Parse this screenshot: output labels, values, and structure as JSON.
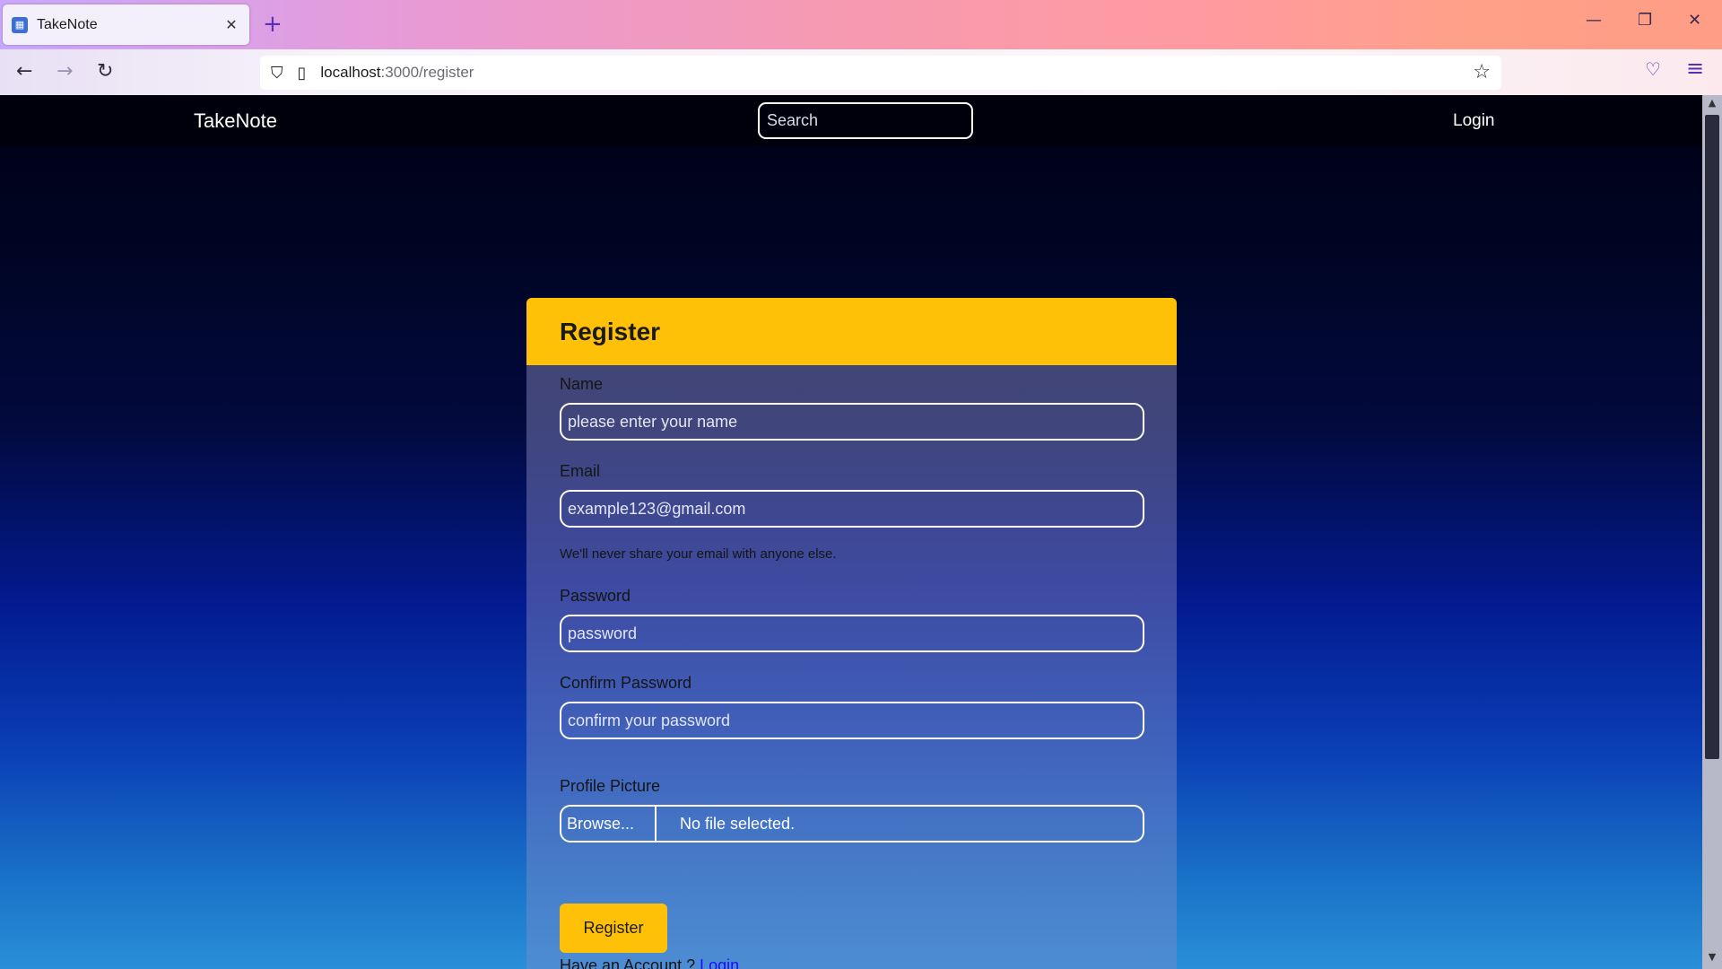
{
  "browser": {
    "tab_title": "TakeNote",
    "tab_close": "✕",
    "new_tab": "+",
    "window_controls": {
      "minimize": "—",
      "restore": "❐",
      "close": "✕"
    },
    "nav": {
      "back": "←",
      "forward": "→",
      "reload": "↻"
    },
    "url": {
      "host": "localhost",
      "path": ":3000/register",
      "shield": "⛉",
      "page": "▯"
    },
    "bookmark_star": "☆",
    "pocket": "♡",
    "menu": "≡"
  },
  "site": {
    "brand": "TakeNote",
    "search_placeholder": "Search",
    "login": "Login"
  },
  "form": {
    "title": "Register",
    "name_label": "Name",
    "name_placeholder": "please enter your name",
    "email_label": "Email",
    "email_placeholder": "example123@gmail.com",
    "email_help": "We'll never share your email with anyone else.",
    "password_label": "Password",
    "password_placeholder": "password",
    "confirm_label": "Confirm Password",
    "confirm_placeholder": "confirm your password",
    "picture_label": "Profile Picture",
    "browse": "Browse...",
    "file_status": "No file selected.",
    "submit": "Register",
    "have_account": "Have an Account ? ",
    "login_link": "Login"
  },
  "colors": {
    "accent": "#ffc107",
    "link": "#1a0dff"
  }
}
